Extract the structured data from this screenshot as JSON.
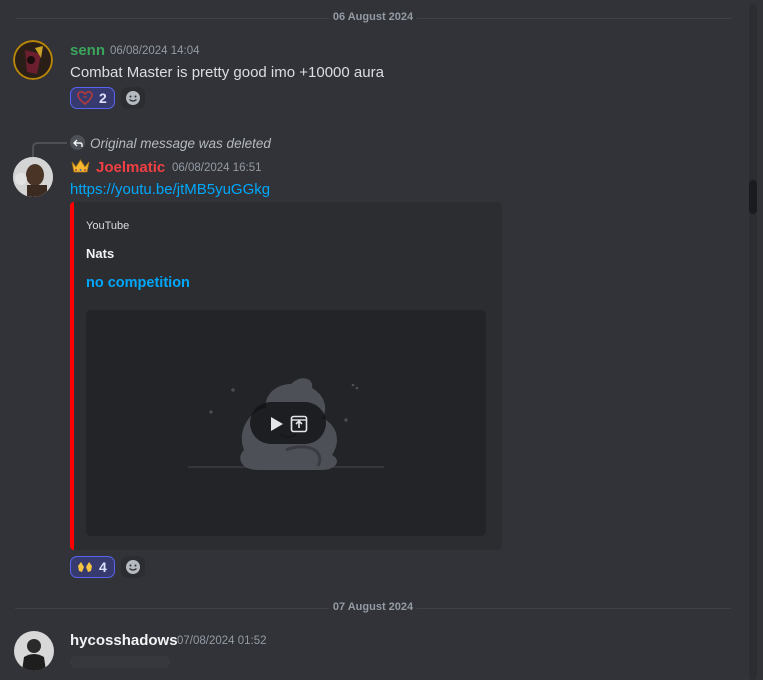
{
  "dividers": {
    "first": "06 August 2024",
    "second": "07 August 2024"
  },
  "messages": [
    {
      "username": "senn",
      "username_color": "#3ba55d",
      "timestamp": "06/08/2024 14:04",
      "text": "Combat Master is pretty good imo +10000 aura",
      "reaction": {
        "icon": "heart-sticker-icon",
        "count": "2"
      }
    },
    {
      "reply_text": "Original message was deleted",
      "badge_icon": "crown-icon",
      "username": "Joelmatic",
      "username_color": "#f23f43",
      "timestamp": "06/08/2024 16:51",
      "link": "https://youtu.be/jtMB5yuGGkg",
      "embed": {
        "provider": "YouTube",
        "author": "Nats",
        "title": "no competition",
        "accent_color": "#ff0000"
      },
      "reaction": {
        "icon": "raised-hands-icon",
        "count": "4"
      }
    },
    {
      "username": "hycosshadows",
      "username_color": "#f2f3f5",
      "timestamp": "07/08/2024 01:52"
    }
  ]
}
